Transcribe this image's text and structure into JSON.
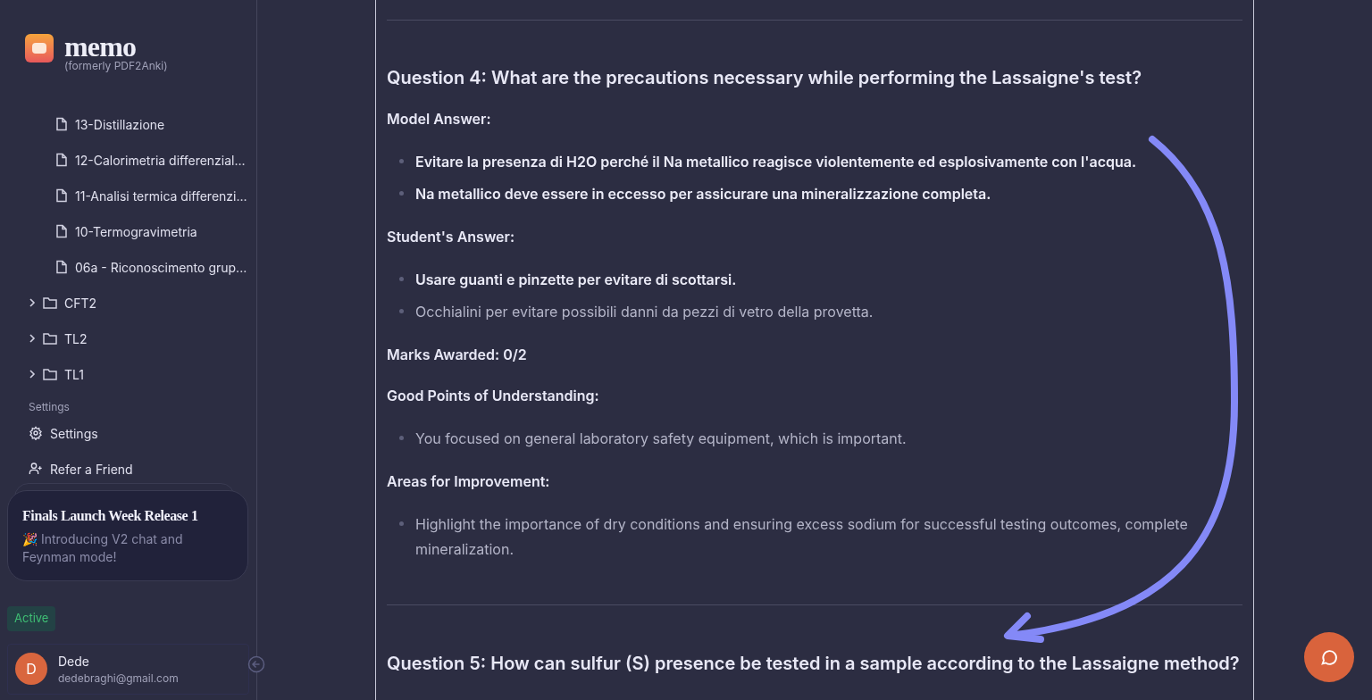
{
  "brand": {
    "name": "memo",
    "subtitle": "(formerly PDF2Anki)"
  },
  "files": [
    {
      "label": "13-Distillazione"
    },
    {
      "label": "12-Calorimetria differenzial..."
    },
    {
      "label": "11-Analisi termica differenzi..."
    },
    {
      "label": "10-Termogravimetria"
    },
    {
      "label": "06a - Riconoscimento grup..."
    }
  ],
  "folders": [
    {
      "label": "CFT2",
      "expanded": false
    },
    {
      "label": "TL2",
      "expanded": false
    },
    {
      "label": "TL1",
      "expanded": false
    }
  ],
  "settings_section": {
    "heading": "Settings",
    "items": [
      {
        "kind": "settings",
        "label": "Settings"
      },
      {
        "kind": "refer",
        "label": "Refer a Friend"
      }
    ]
  },
  "announcement": {
    "title": "Finals Launch Week Release 1",
    "body": "🎉 Introducing V2 chat and Feynman mode!"
  },
  "status_badge": "Active",
  "user": {
    "initial": "D",
    "name": "Dede",
    "email": "dedebraghi@gmail.com"
  },
  "content": [
    {
      "kind": "divider"
    },
    {
      "kind": "heading",
      "text": "Question 4: What are the precautions necessary while performing the Lassaigne's test?"
    },
    {
      "kind": "label",
      "text": "Model Answer:"
    },
    {
      "kind": "bullets",
      "items": [
        {
          "text": "Evitare la presenza di H2O perché il Na metallico reagisce violentemente ed esplosivamente con l'acqua.",
          "bold": true
        },
        {
          "text": "Na metallico deve essere in eccesso per assicurare una mineralizzazione completa.",
          "bold": true
        }
      ]
    },
    {
      "kind": "label",
      "text": "Student's Answer:"
    },
    {
      "kind": "bullets",
      "items": [
        {
          "text": "Usare guanti e pinzette per evitare di scottarsi.",
          "bold": true
        },
        {
          "text": "Occhialini per evitare possibili danni da pezzi di vetro della provetta.",
          "bold": false
        }
      ]
    },
    {
      "kind": "label",
      "text": "Marks Awarded: 0/2"
    },
    {
      "kind": "label",
      "text": "Good Points of Understanding:"
    },
    {
      "kind": "bullets",
      "items": [
        {
          "text": "You focused on general laboratory safety equipment, which is important.",
          "bold": false
        }
      ]
    },
    {
      "kind": "label",
      "text": "Areas for Improvement:"
    },
    {
      "kind": "bullets",
      "items": [
        {
          "text": "Highlight the importance of dry conditions and ensuring excess sodium for successful testing outcomes, complete mineralization.",
          "bold": false
        }
      ]
    },
    {
      "kind": "divider"
    },
    {
      "kind": "heading",
      "text": "Question 5: How can sulfur (S) presence be tested in a sample according to the Lassaigne method?"
    }
  ]
}
